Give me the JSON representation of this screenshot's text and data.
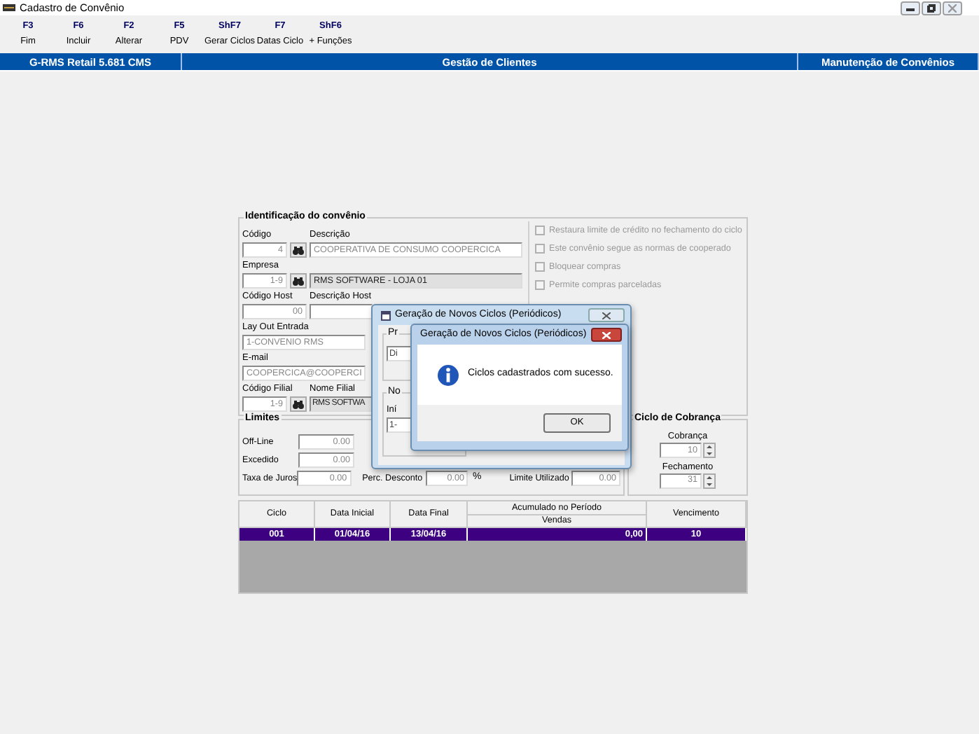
{
  "window": {
    "title": "Cadastro de Convênio"
  },
  "toolbar": [
    {
      "key": "F3",
      "label": "Fim"
    },
    {
      "key": "F6",
      "label": "Incluir"
    },
    {
      "key": "F2",
      "label": "Alterar"
    },
    {
      "key": "F5",
      "label": "PDV"
    },
    {
      "key": "ShF7",
      "label": "Gerar Ciclos"
    },
    {
      "key": "F7",
      "label": "Datas Ciclo"
    },
    {
      "key": "ShF6",
      "label": "+ Funções"
    }
  ],
  "header_bar": [
    "G-RMS Retail 5.681 CMS",
    "Gestão de Clientes",
    "Manutenção de Convênios"
  ],
  "identification": {
    "title": "Identificação do convênio",
    "rows": [
      {
        "label": "Código",
        "value": "4",
        "lookup": true,
        "second": {
          "label": "Descrição",
          "value": "COOPERATIVA DE CONSUMO COOPERCICA",
          "shaded": false
        }
      },
      {
        "label": "Empresa",
        "value": "1-9",
        "lookup": true,
        "second": {
          "value": "RMS SOFTWARE - LOJA 01",
          "shaded": true
        }
      },
      {
        "label": "Código Host",
        "value": "00",
        "lookup": false,
        "second": {
          "label": "Descrição Host",
          "shaded": false
        }
      },
      {
        "label": "Lay Out Entrada",
        "value": "1-CONVENIO RMS",
        "wide": true
      },
      {
        "label": "E-mail",
        "value": "COOPERCICA@COOPERCI",
        "wide": true
      },
      {
        "label": "Código Filial",
        "value": "1-9",
        "lookup": true,
        "second": {
          "label": "Nome Filial",
          "value": "RMS SOFTWA",
          "shaded": true
        }
      }
    ]
  },
  "checkboxes": [
    {
      "label": "Restaura limite de crédito no fechamento do ciclo",
      "checked": false,
      "disabled": true
    },
    {
      "label": "Este convênio segue as normas de cooperado",
      "checked": false,
      "disabled": true
    },
    {
      "label": "Bloquear compras",
      "checked": false,
      "disabled": true
    },
    {
      "label": "Permite compras parceladas",
      "checked": false,
      "disabled": true
    }
  ],
  "limits": {
    "title": "Limites",
    "fields": [
      {
        "label": "Off-Line",
        "value": "0.00"
      },
      {
        "label": "Excedido",
        "value": "0.00"
      },
      {
        "label": "Taxa de Juros",
        "value": "0.00"
      }
    ],
    "extra": [
      {
        "label": "Perc. Desconto",
        "value": "0.00",
        "unit": "%"
      },
      {
        "label": "Limite Utilizado",
        "value": "0.00"
      }
    ]
  },
  "billing_cycle": {
    "title": "Ciclo de Cobrança",
    "fields": [
      {
        "label": "Cobrança",
        "value": "10"
      },
      {
        "label": "Fechamento",
        "value": "31"
      }
    ]
  },
  "table": {
    "columns": [
      {
        "label": "Ciclo"
      },
      {
        "label": "Data Inicial"
      },
      {
        "label": "Data Final"
      },
      {
        "label": "Acumulado no Período",
        "sub": "Vendas"
      },
      {
        "label": "Vencimento"
      }
    ],
    "rows": [
      {
        "cells": [
          "001",
          "01/04/16",
          "13/04/16",
          "0,00",
          "10"
        ],
        "selected": true
      }
    ]
  },
  "background_dialog": {
    "title": "Geração de Novos Ciclos (Periódicos)",
    "groups": [
      {
        "legend": "Pr",
        "value": "Di"
      },
      {
        "legend": "No",
        "label": "Iní",
        "value": "1-"
      }
    ]
  },
  "message_box": {
    "title": "Geração de Novos Ciclos (Periódicos)",
    "text": "Ciclos cadastrados com sucesso.",
    "button": "OK"
  }
}
